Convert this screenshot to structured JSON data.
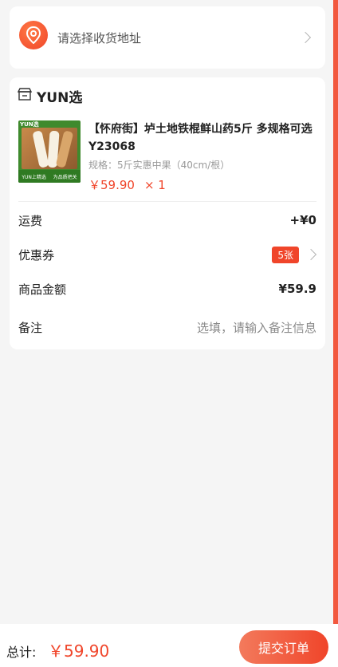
{
  "address": {
    "placeholder_text": "请选择收货地址",
    "icon": "location-pin-icon"
  },
  "shop": {
    "icon": "shop-icon",
    "name": "YUN选"
  },
  "product": {
    "title": "【怀府街】垆土地铁棍鲜山药5斤 多规格可选Y23068",
    "spec": "规格：5斤实惠中果（40cm/根）",
    "price": "￥59.90",
    "quantity": "× 1",
    "image_top_label": "YUN选",
    "image_bottom_left": "YUN上精选",
    "image_bottom_right": "为品质把关"
  },
  "rows": {
    "shipping": {
      "label": "运费",
      "value": "+¥0"
    },
    "coupon": {
      "label": "优惠券",
      "badge": "5张"
    },
    "amount": {
      "label": "商品金额",
      "value": "¥59.9"
    },
    "remark": {
      "label": "备注",
      "placeholder": "选填，请输入备注信息"
    }
  },
  "footer": {
    "total_label": "总计:",
    "total_amount": "￥59.90",
    "submit_label": "提交订单"
  },
  "colors": {
    "accent": "#f0452a",
    "background": "#f5f5f5"
  }
}
